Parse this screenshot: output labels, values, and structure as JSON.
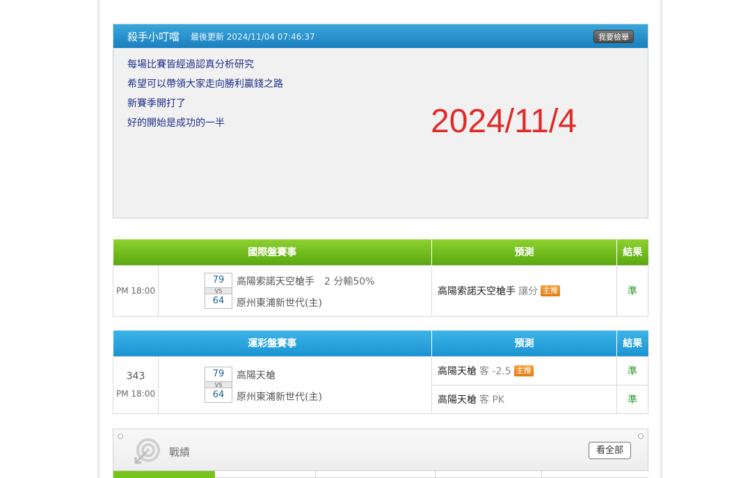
{
  "expert": {
    "name": "殺手小叮噹",
    "updated": "最後更新 2024/11/04 07:46:37",
    "report_button": "我要檢舉",
    "lines": [
      "每場比賽皆經過認真分析研究",
      "希望可以帶領大家走向勝利贏錢之路",
      "新賽季開打了",
      "好的開始是成功的一半"
    ],
    "big_date": "2024/11/4"
  },
  "intl": {
    "headers": [
      "國際盤賽事",
      "預測",
      "結果"
    ],
    "match": {
      "time": "PM 18:00",
      "score_away": "79",
      "score_home": "64",
      "vs": "VS",
      "team_away": "高陽索諾天空槍手",
      "handicap": "2 分輸50%",
      "team_home": "原州東浦新世代(主)",
      "pred_team": "高陽索諾天空槍手",
      "pred_sub": "讓分",
      "badge": "主推",
      "result": "準"
    }
  },
  "lottery": {
    "headers": [
      "運彩盤賽事",
      "預測",
      "結果"
    ],
    "match": {
      "number": "343",
      "time": "PM 18:00",
      "score_away": "79",
      "score_home": "64",
      "vs": "VS",
      "team_away": "高陽天槍",
      "team_home": "原州東浦新世代(主)",
      "preds": [
        {
          "team": "高陽天槍",
          "sub": "客 -2.5",
          "badge": "主推",
          "result": "準"
        },
        {
          "team": "高陽天槍",
          "sub": "客 PK",
          "badge": "",
          "result": "準"
        }
      ]
    }
  },
  "record": {
    "title": "戰績",
    "view_all": "看全部"
  },
  "colors": {
    "green": "#6ab81a",
    "blue": "#1f9ad6",
    "date_red": "#e02a2a",
    "result_green": "#2e9a2e"
  }
}
